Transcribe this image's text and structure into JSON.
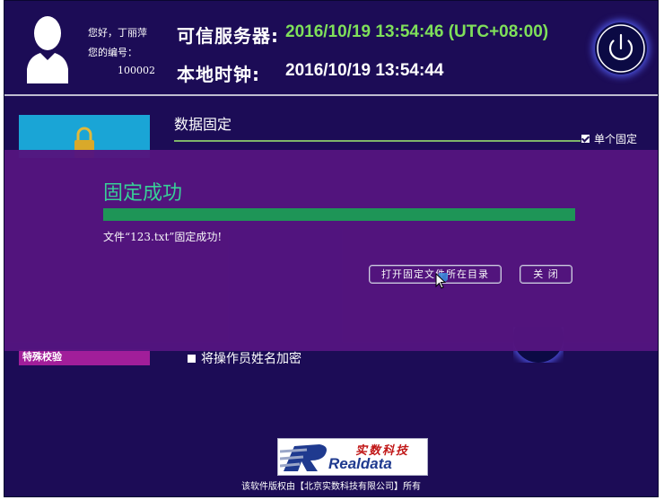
{
  "user": {
    "greeting": "您好，丁丽萍",
    "id_label": "您的编号：",
    "id_value": "100002"
  },
  "header": {
    "server_label": "可信服务器:",
    "server_time": "2016/10/19 13:54:46 (UTC+08:00)",
    "local_label": "本地时钟:",
    "local_time": "2016/10/19 13:54:44"
  },
  "section": {
    "title": "数据固定",
    "single_fix_label": "单个固定",
    "single_fix_checked": true
  },
  "sidebar": {
    "special_check_label": "特殊校验"
  },
  "options": {
    "encrypt_label": "将操作员姓名加密",
    "encrypt_checked": false
  },
  "dialog": {
    "title": "固定成功",
    "progress_percent": 100,
    "message": "文件“123.txt”固定成功!",
    "open_dir_label": "打开固定文件所在目录",
    "close_label": "关 闭"
  },
  "footer": {
    "logo_cn": "实数科技",
    "logo_en": "Realdata",
    "copyright": "该软件版权由【北京实数科技有限公司】所有"
  },
  "colors": {
    "background": "#1c0c56",
    "server_time": "#7fe05a",
    "dialog_bg": "#54157f",
    "dialog_title": "#39d69a",
    "progress": "#1f9a58",
    "tile_blue": "#1aa5d6",
    "tile_magenta": "#a11e9a"
  },
  "icons": {
    "avatar": "user-silhouette-icon",
    "power": "power-icon",
    "lock": "padlock-icon"
  }
}
